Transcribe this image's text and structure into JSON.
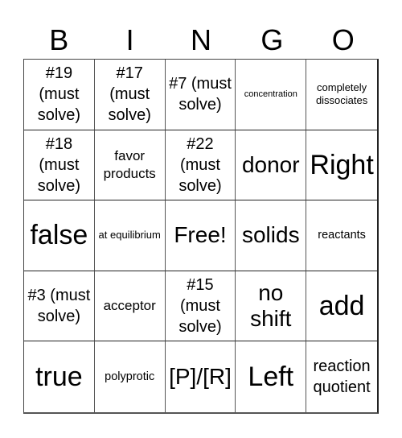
{
  "header": {
    "letters": [
      "B",
      "I",
      "N",
      "G",
      "O"
    ]
  },
  "board": {
    "rows": [
      [
        {
          "text": "#19 (must solve)",
          "size": "md"
        },
        {
          "text": "#17 (must solve)",
          "size": "md"
        },
        {
          "text": "#7 (must solve)",
          "size": "md"
        },
        {
          "text": "concentration",
          "size": "tiny"
        },
        {
          "text": "completely dissociates",
          "size": "xxs"
        }
      ],
      [
        {
          "text": "#18 (must solve)",
          "size": "md"
        },
        {
          "text": "favor products",
          "size": "sm"
        },
        {
          "text": "#22 (must solve)",
          "size": "md"
        },
        {
          "text": "donor",
          "size": "lg"
        },
        {
          "text": "Right",
          "size": "xl"
        }
      ],
      [
        {
          "text": "false",
          "size": "xl"
        },
        {
          "text": "at equilibrium",
          "size": "xxs"
        },
        {
          "text": "Free!",
          "size": "lg"
        },
        {
          "text": "solids",
          "size": "lg"
        },
        {
          "text": "reactants",
          "size": "xs"
        }
      ],
      [
        {
          "text": "#3 (must solve)",
          "size": "md"
        },
        {
          "text": "acceptor",
          "size": "sm"
        },
        {
          "text": "#15 (must solve)",
          "size": "md"
        },
        {
          "text": "no shift",
          "size": "lg"
        },
        {
          "text": "add",
          "size": "xl"
        }
      ],
      [
        {
          "text": "true",
          "size": "xl"
        },
        {
          "text": "polyprotic",
          "size": "xs"
        },
        {
          "text": "[P]/[R]",
          "size": "lg"
        },
        {
          "text": "Left",
          "size": "xl"
        },
        {
          "text": "reaction quotient",
          "size": "md"
        }
      ]
    ]
  }
}
